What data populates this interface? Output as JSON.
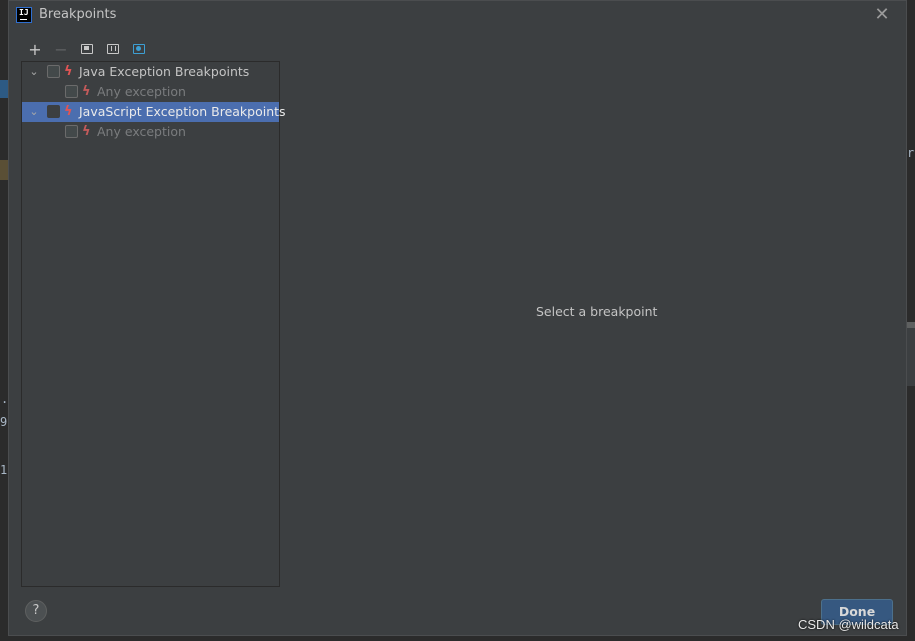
{
  "window": {
    "title": "Breakpoints",
    "app_icon_text": "IJ",
    "close_glyph": "✕"
  },
  "toolbar": {
    "add_glyph": "+",
    "remove_glyph": "−",
    "icons": [
      "add-icon",
      "remove-icon",
      "group-by-file-icon",
      "group-by-class-icon",
      "group-by-package-icon"
    ]
  },
  "tree": {
    "rows": [
      {
        "label": "Java Exception Breakpoints",
        "expanded": true,
        "checked": false,
        "selected": false,
        "level": 0
      },
      {
        "label": "Any exception",
        "checked": false,
        "selected": false,
        "level": 1
      },
      {
        "label": "JavaScript Exception Breakpoints",
        "expanded": true,
        "checked": false,
        "selected": true,
        "level": 0
      },
      {
        "label": "Any exception",
        "checked": false,
        "selected": false,
        "level": 1
      }
    ],
    "chevron_glyph": "⌄",
    "bolt_glyph": "ϟ"
  },
  "detail": {
    "empty_text": "Select a breakpoint"
  },
  "footer": {
    "help_label": "?",
    "done_label": "Done"
  },
  "background": {
    "chars": [
      "r",
      ".",
      "9",
      "1"
    ]
  },
  "watermark": "CSDN @wildcata",
  "colors": {
    "selection": "#4b6eaf",
    "dialog_bg": "#3c3f41",
    "accent_button": "#365880",
    "bolt": "#e05555"
  }
}
